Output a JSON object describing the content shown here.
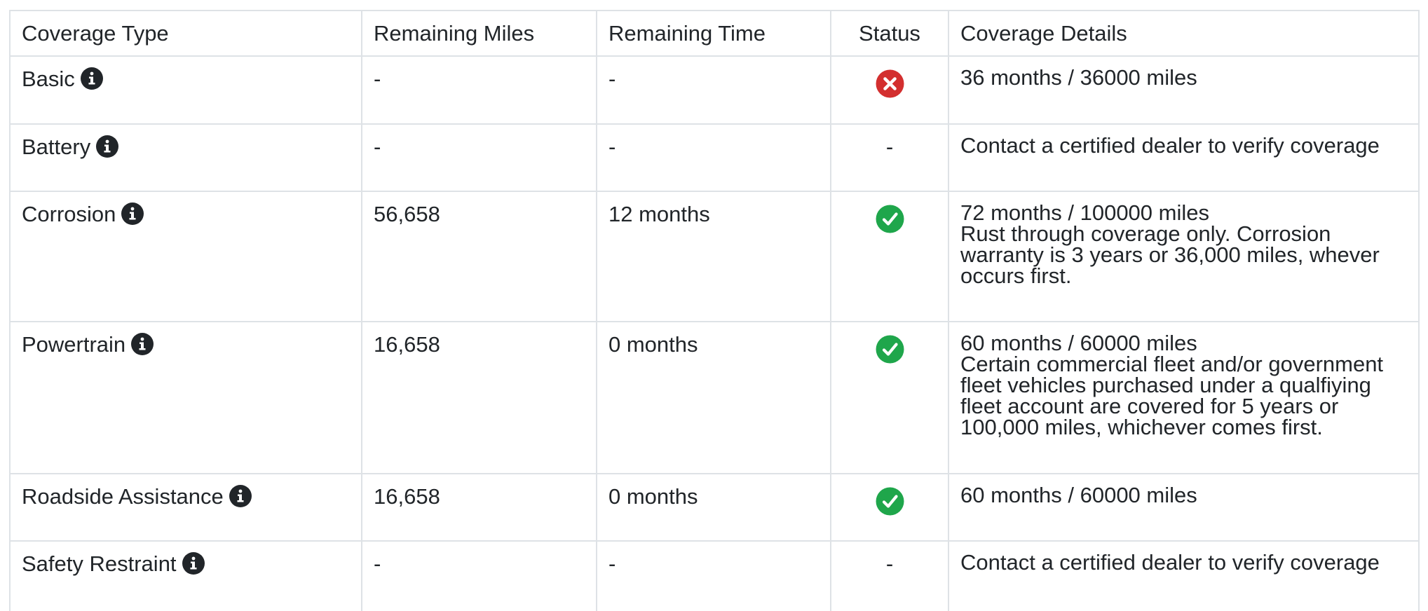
{
  "colors": {
    "error": "#d32f2f",
    "success": "#1fa64b",
    "info_icon": "#212529",
    "border": "#dee2e6",
    "text": "#212529"
  },
  "table": {
    "headers": [
      "Coverage Type",
      "Remaining Miles",
      "Remaining Time",
      "Status",
      "Coverage Details"
    ],
    "rows": [
      {
        "type": "Basic",
        "info_icon": "info-icon",
        "miles": "-",
        "time": "-",
        "status": "error",
        "status_text": "",
        "details": "36 months / 36000 miles",
        "note": ""
      },
      {
        "type": "Battery",
        "info_icon": "info-icon",
        "miles": "-",
        "time": "-",
        "status": "none",
        "status_text": "-",
        "details": "Contact a certified dealer to verify coverage",
        "note": ""
      },
      {
        "type": "Corrosion",
        "info_icon": "info-icon",
        "miles": "56,658",
        "time": "12 months",
        "status": "active",
        "status_text": "",
        "details": "72 months / 100000 miles",
        "note": "Rust through coverage only. Corrosion warranty is 3 years or 36,000 miles, whever occurs first."
      },
      {
        "type": "Powertrain",
        "info_icon": "info-icon",
        "miles": "16,658",
        "time": "0 months",
        "status": "active",
        "status_text": "",
        "details": "60 months / 60000 miles",
        "note": "Certain commercial fleet and/or government fleet vehicles purchased under a qualfiying fleet account are covered for 5 years or 100,000 miles, whichever comes first."
      },
      {
        "type": "Roadside Assistance",
        "info_icon": "info-icon",
        "miles": "16,658",
        "time": "0 months",
        "status": "active",
        "status_text": "",
        "details": "60 months / 60000 miles",
        "note": ""
      },
      {
        "type": "Safety Restraint",
        "info_icon": "info-icon",
        "miles": "-",
        "time": "-",
        "status": "none",
        "status_text": "-",
        "details": "Contact a certified dealer to verify coverage",
        "note": ""
      }
    ]
  }
}
